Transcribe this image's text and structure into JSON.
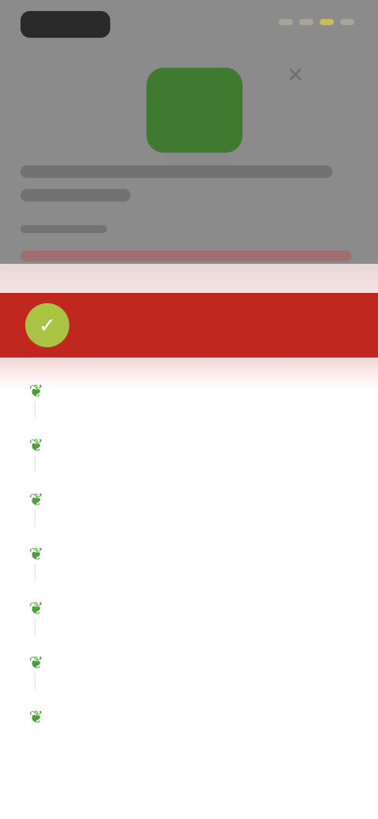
{
  "background_app": {
    "close_icon": "close-icon"
  },
  "active_banner": {
    "text": "",
    "icon": "check-icon",
    "color": "#c0281f"
  },
  "menu": {
    "items": [
      {
        "label": "",
        "icon": "leaf-icon"
      },
      {
        "label": "",
        "icon": "leaf-icon"
      },
      {
        "label": "",
        "icon": "leaf-icon"
      },
      {
        "label": "",
        "icon": "leaf-icon"
      },
      {
        "label": "",
        "icon": "leaf-icon"
      },
      {
        "label": "",
        "icon": "leaf-icon"
      },
      {
        "label": "",
        "icon": "leaf-icon"
      }
    ],
    "accent_color": "#4e9e3a"
  }
}
